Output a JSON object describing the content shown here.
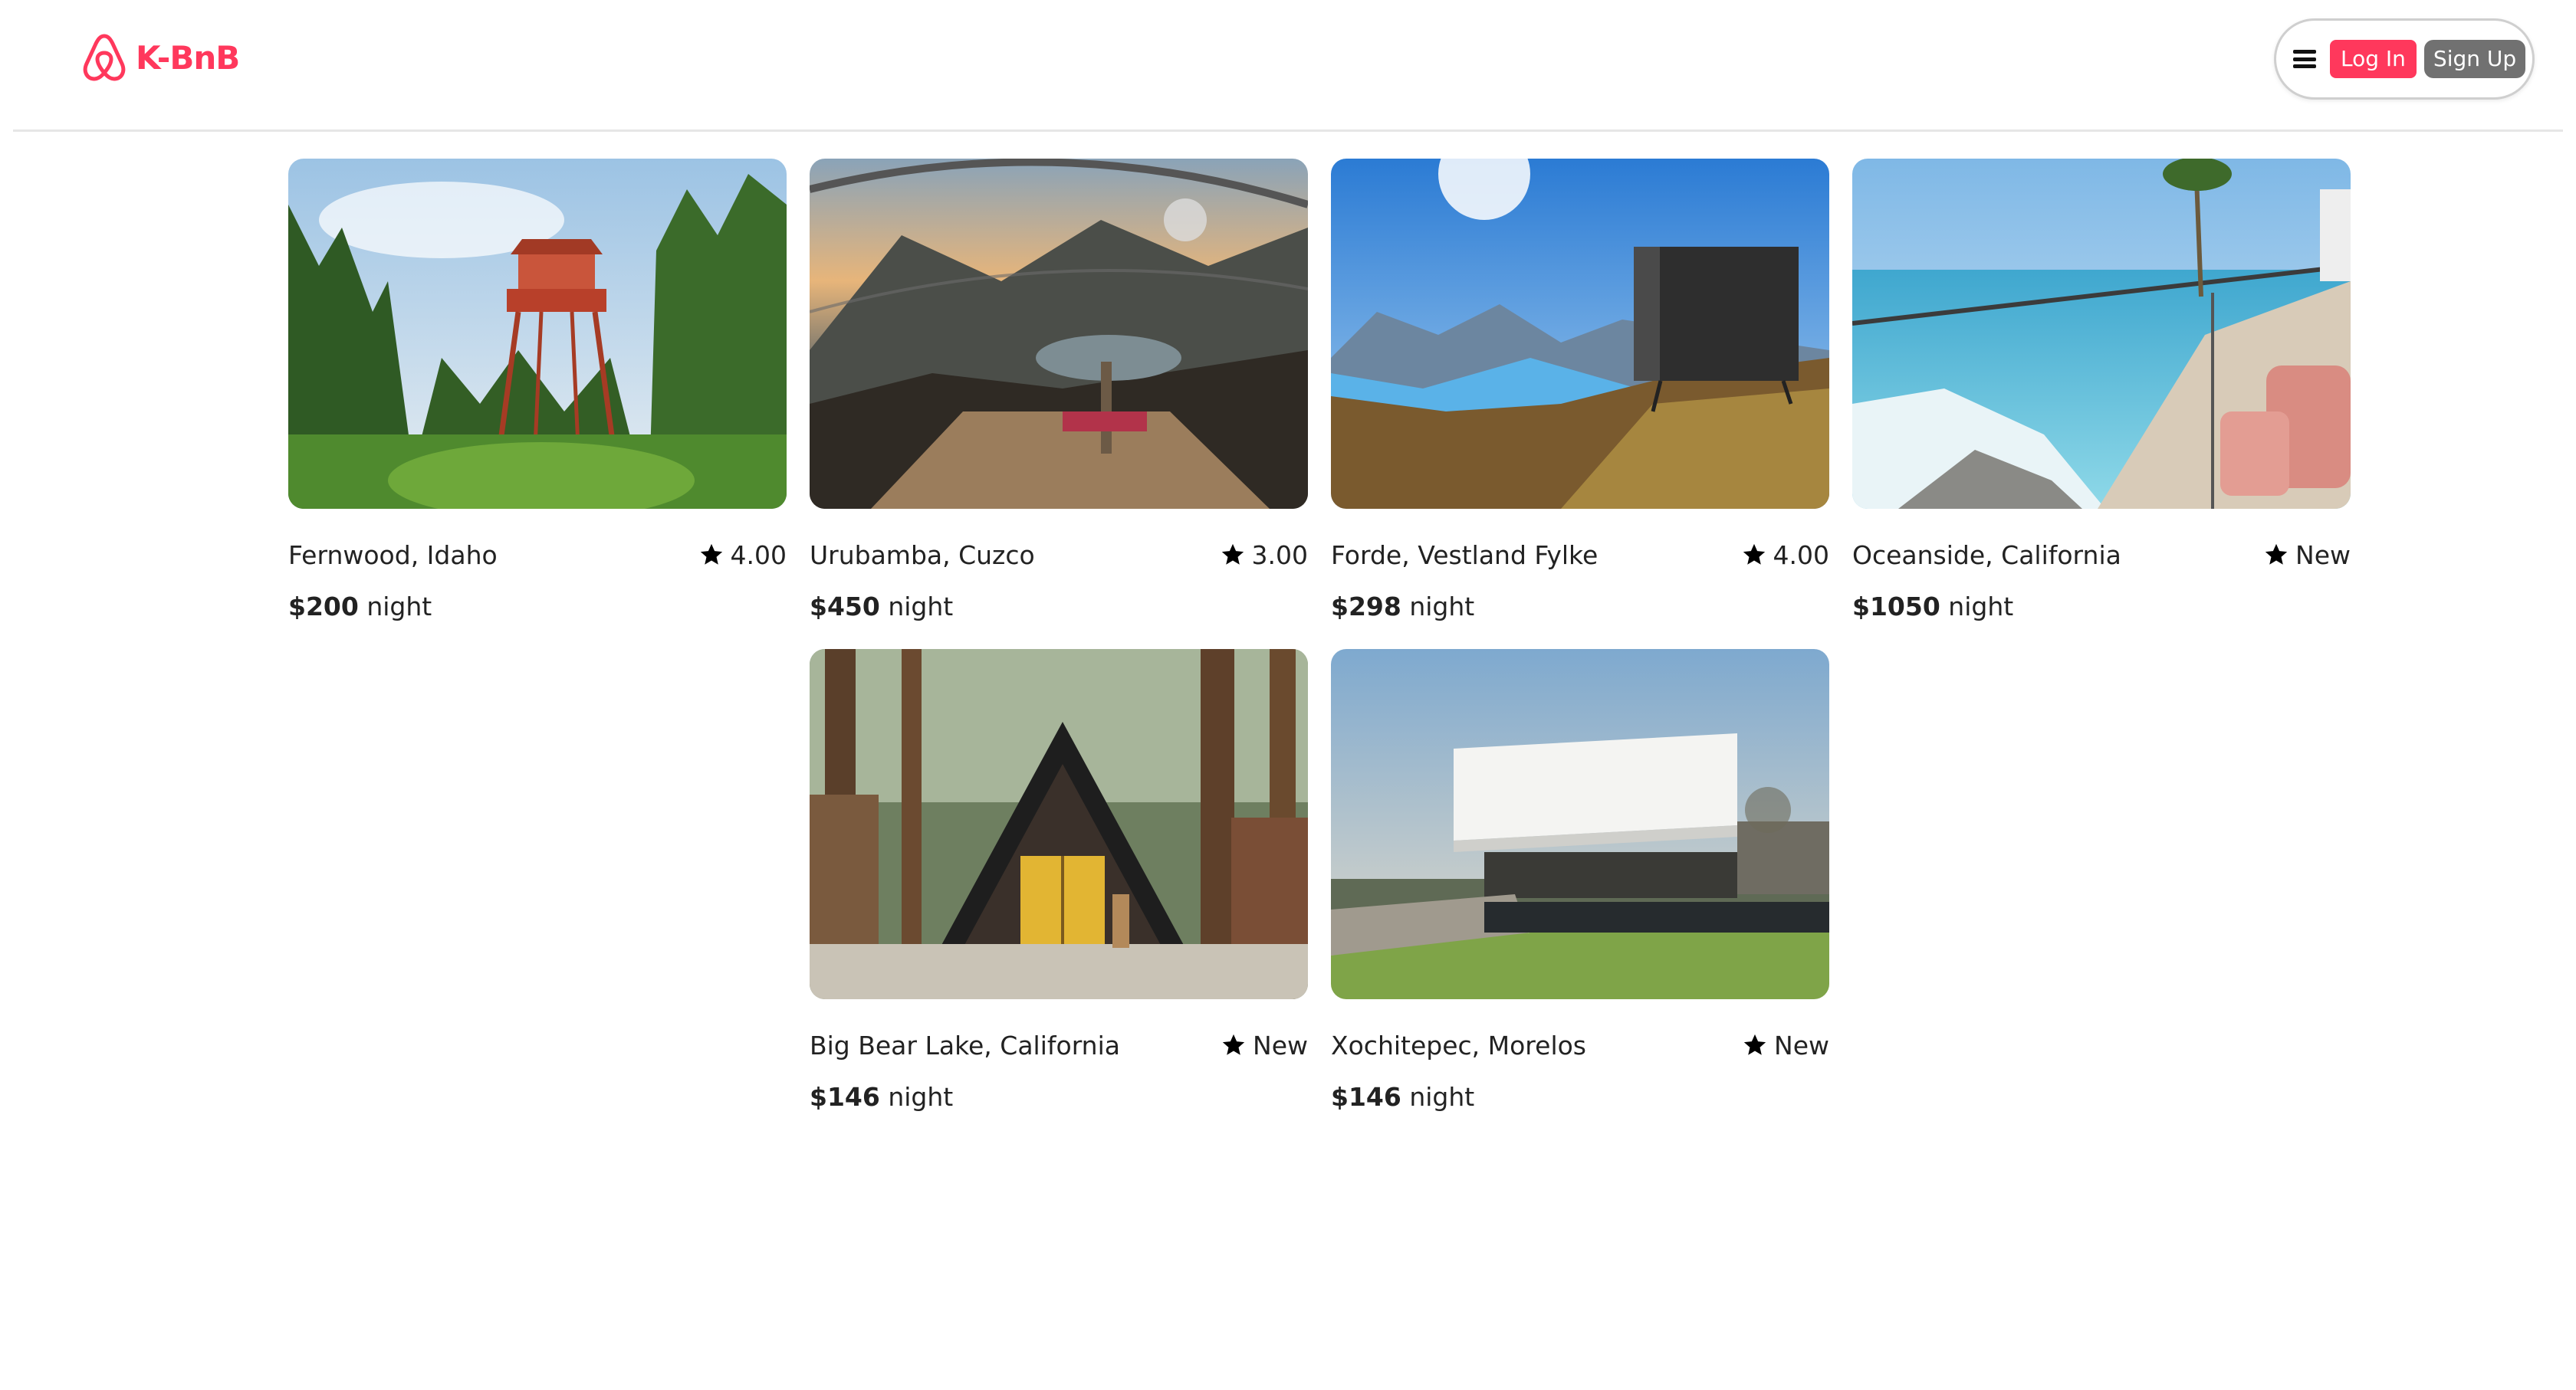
{
  "brand": {
    "name": "K-BnB",
    "color": "#ff385c"
  },
  "header": {
    "menu_icon": "hamburger-icon",
    "login_label": "Log In",
    "signup_label": "Sign Up"
  },
  "listings": [
    {
      "location": "Fernwood, Idaho",
      "rating": "4.00",
      "price": "$200",
      "unit": " night",
      "scene": "fire-lookout-tower-forest"
    },
    {
      "location": "Urubamba, Cuzco",
      "rating": "3.00",
      "price": "$450",
      "unit": " night",
      "scene": "glass-capsule-mountain-view"
    },
    {
      "location": "Forde, Vestland Fylke",
      "rating": "4.00",
      "price": "$298",
      "unit": " night",
      "scene": "cabin-on-cliff-fjord"
    },
    {
      "location": "Oceanside, California",
      "rating": "New",
      "price": "$1050",
      "unit": " night",
      "scene": "beach-balcony-chairs"
    },
    {
      "location": "Big Bear Lake, California",
      "rating": "New",
      "price": "$146",
      "unit": " night",
      "scene": "a-frame-cabin-pines"
    },
    {
      "location": "Xochitepec, Morelos",
      "rating": "New",
      "price": "$146",
      "unit": " night",
      "scene": "modern-house-lawn"
    }
  ]
}
